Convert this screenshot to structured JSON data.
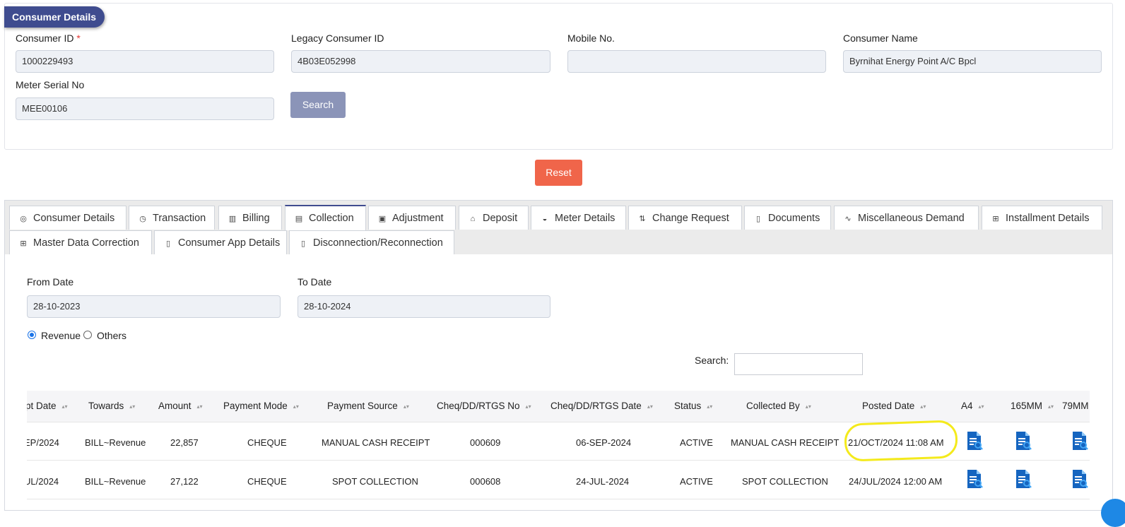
{
  "consumer_section": {
    "title": "Consumer Details",
    "fields": {
      "consumer_id": {
        "label": "Consumer ID",
        "required_mark": "*",
        "value": "1000229493"
      },
      "legacy_consumer_id": {
        "label": "Legacy Consumer ID",
        "value": "4B03E052998"
      },
      "mobile_no": {
        "label": "Mobile No.",
        "value": ""
      },
      "consumer_name": {
        "label": "Consumer Name",
        "value": "Byrnihat Energy Point A/C Bpcl"
      },
      "meter_serial_no": {
        "label": "Meter Serial No",
        "value": "MEE00106"
      }
    },
    "search_label": "Search",
    "reset_label": "Reset"
  },
  "tabs": [
    {
      "label": "Consumer Details",
      "icon": "target-icon"
    },
    {
      "label": "Transaction",
      "icon": "clock-icon"
    },
    {
      "label": "Billing",
      "icon": "bar-chart-icon"
    },
    {
      "label": "Collection",
      "icon": "collection-icon",
      "active": true
    },
    {
      "label": "Adjustment",
      "icon": "image-icon"
    },
    {
      "label": "Deposit",
      "icon": "bank-icon"
    },
    {
      "label": "Meter Details",
      "icon": "gauge-icon"
    },
    {
      "label": "Change Request",
      "icon": "git-pull-icon"
    },
    {
      "label": "Documents",
      "icon": "file-icon"
    },
    {
      "label": "Miscellaneous Demand",
      "icon": "pulse-icon"
    },
    {
      "label": "Installment Details",
      "icon": "plus-box-icon"
    },
    {
      "label": "Master Data Correction",
      "icon": "plus-box-icon"
    },
    {
      "label": "Consumer App Details",
      "icon": "phone-icon"
    },
    {
      "label": "Disconnection/Reconnection",
      "icon": "phone-icon"
    }
  ],
  "collection": {
    "from_date": {
      "label": "From Date",
      "value": "28-10-2023"
    },
    "to_date": {
      "label": "To Date",
      "value": "28-10-2024"
    },
    "radio": [
      {
        "label": "Revenue",
        "checked": true
      },
      {
        "label": "Others",
        "checked": false
      }
    ],
    "search_label": "Search:",
    "search_value": ""
  },
  "table": {
    "columns": [
      "pt Date",
      "Towards",
      "Amount",
      "Payment Mode",
      "Payment Source",
      "Cheq/DD/RTGS No",
      "Cheq/DD/RTGS Date",
      "Status",
      "Collected By",
      "Posted Date",
      "A4",
      "165MM",
      "79MM"
    ],
    "rows": [
      [
        "EP/2024",
        "BILL~Revenue",
        "22,857",
        "CHEQUE",
        "MANUAL CASH RECEIPT",
        "000609",
        "06-SEP-2024",
        "ACTIVE",
        "MANUAL CASH RECEIPT",
        "21/OCT/2024 11:08 AM"
      ],
      [
        "UL/2024",
        "BILL~Revenue",
        "27,122",
        "CHEQUE",
        "SPOT COLLECTION",
        "000608",
        "24-JUL-2024",
        "ACTIVE",
        "SPOT COLLECTION",
        "24/JUL/2024 12:00 AM"
      ]
    ]
  },
  "colors": {
    "primary": "#3f4c8f",
    "reset": "#f0654a",
    "search_button": "#8b94b8",
    "doc_icon": "#1565c0",
    "highlight": "#f4ea1c"
  }
}
